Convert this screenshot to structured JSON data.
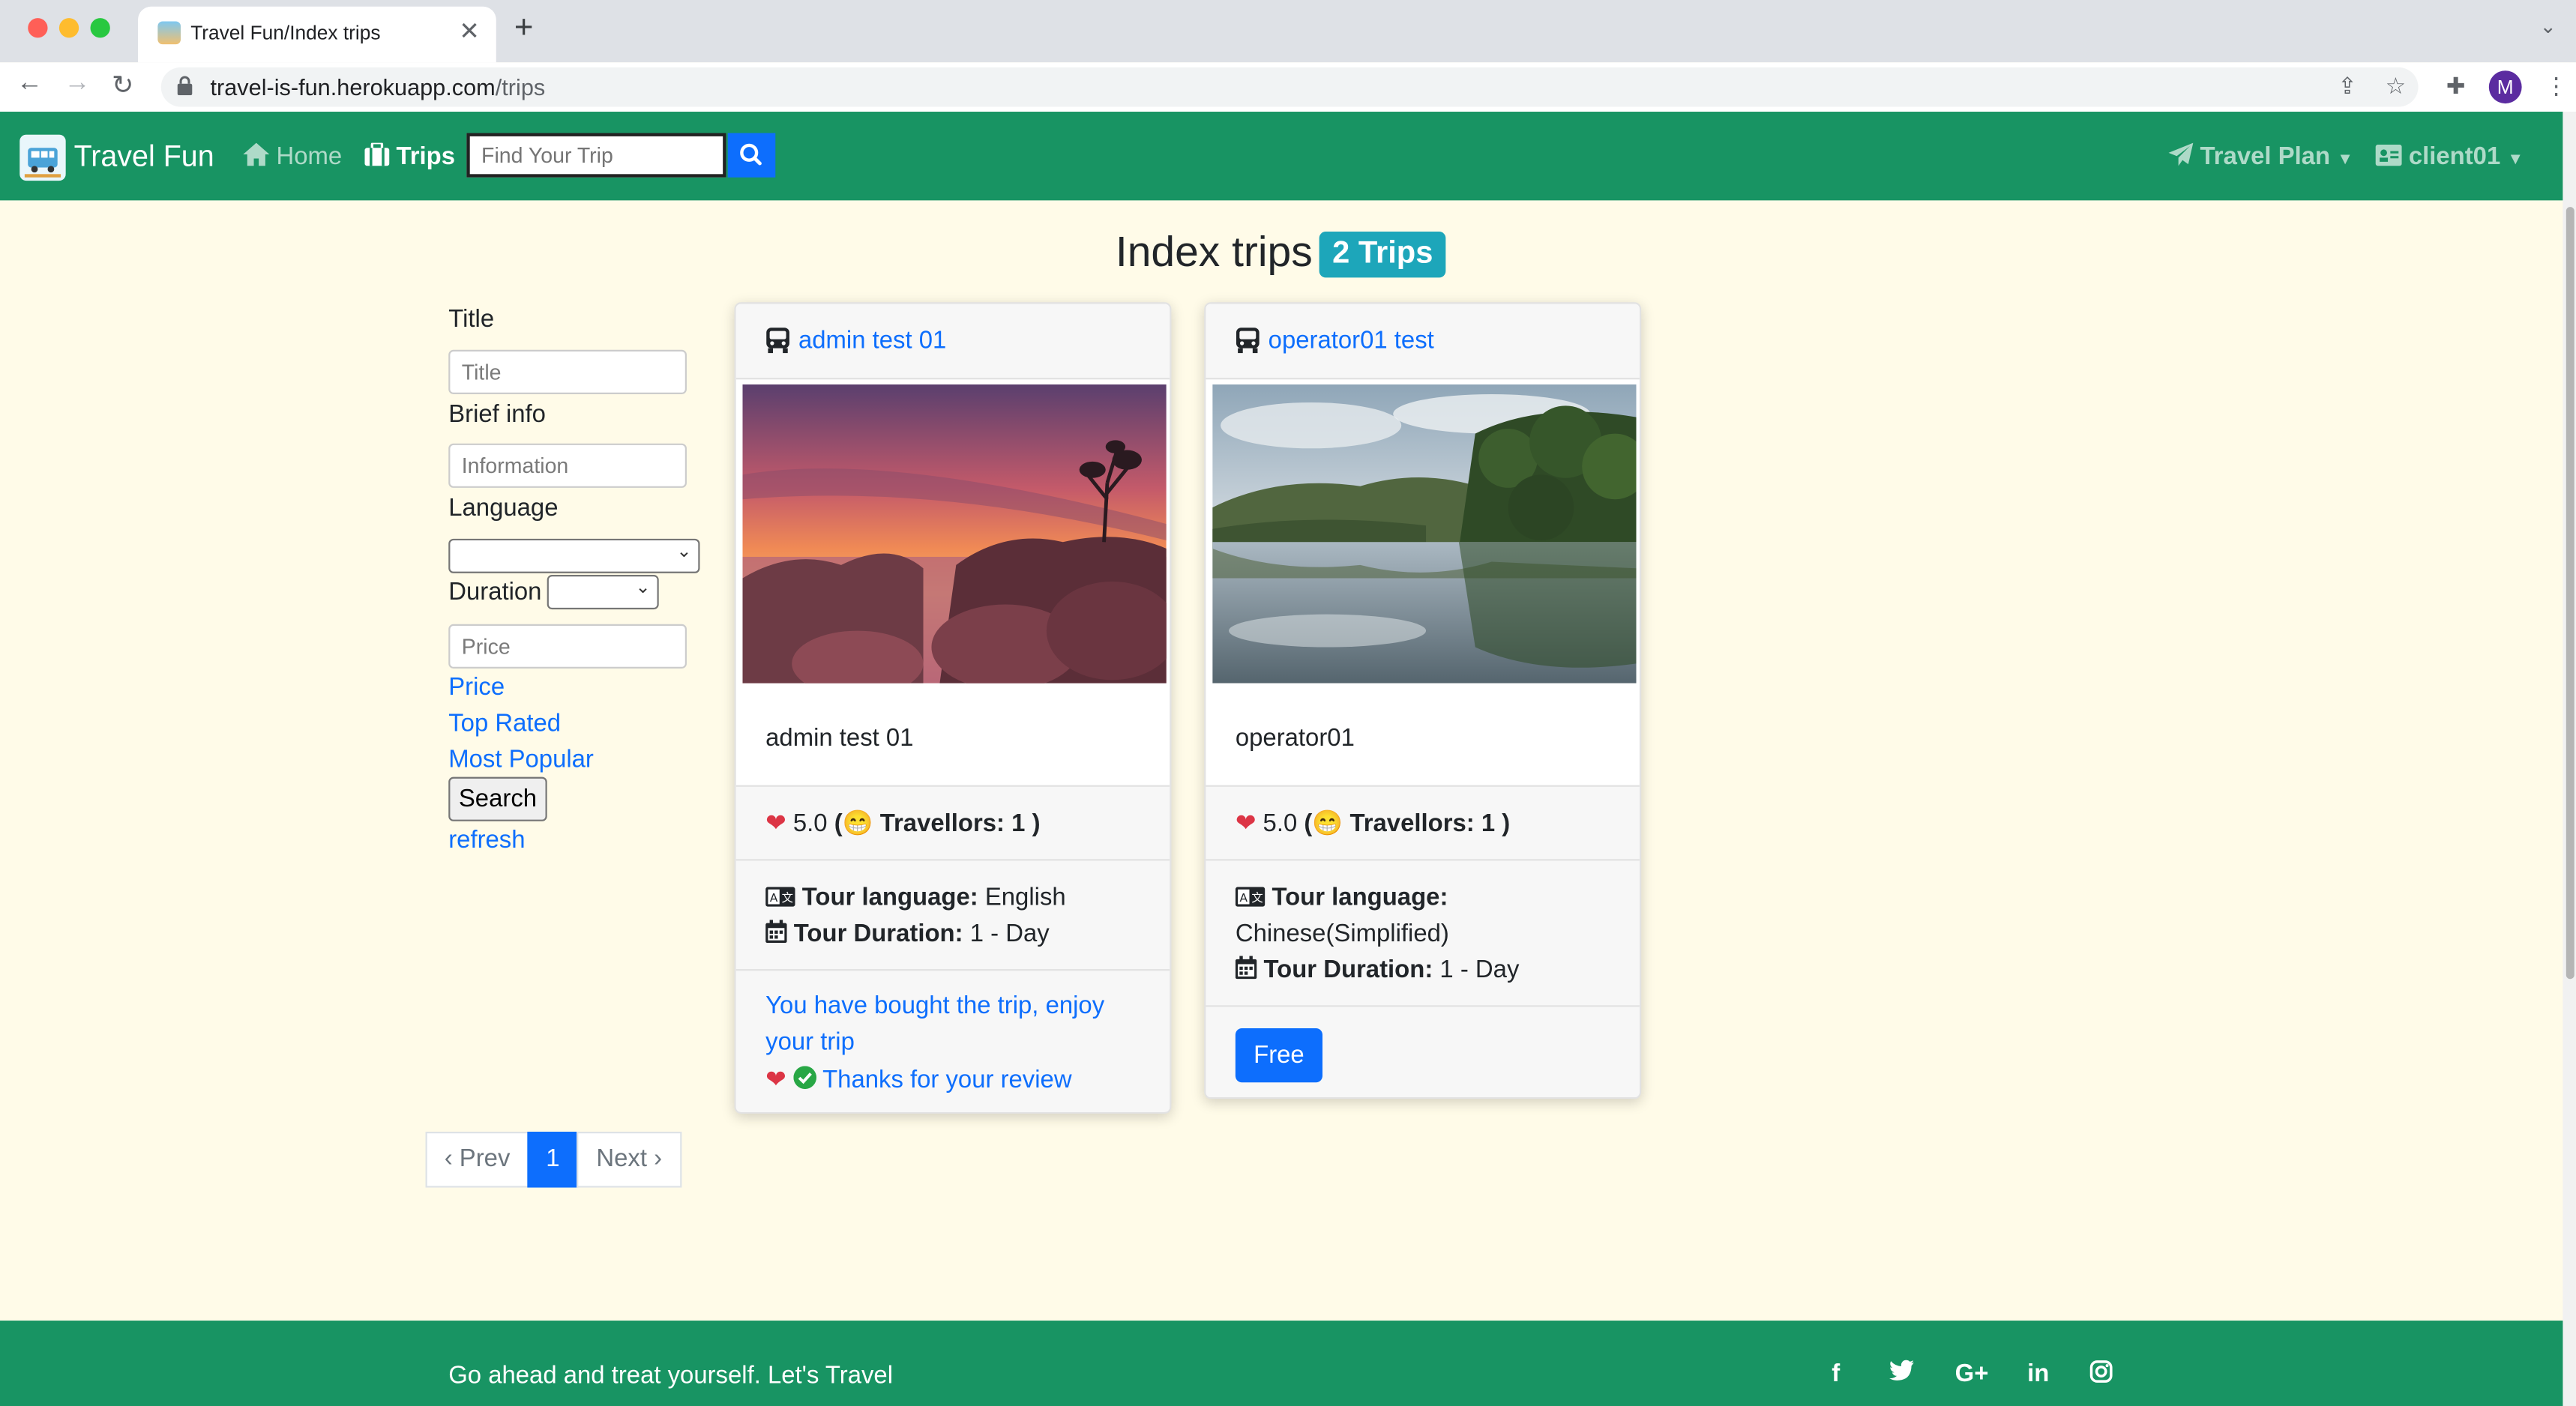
{
  "browser": {
    "tab_title": "Travel Fun/Index trips",
    "url_host": "travel-is-fun.herokuapp.com",
    "url_path": "/trips",
    "profile_initial": "M"
  },
  "navbar": {
    "brand": "Travel Fun",
    "home_label": "Home",
    "trips_label": "Trips",
    "search_placeholder": "Find Your Trip",
    "travel_plan_label": "Travel Plan",
    "user_label": "client01"
  },
  "page": {
    "title": "Index trips",
    "count_badge": "2 Trips"
  },
  "filters": {
    "title_label": "Title",
    "title_placeholder": "Title",
    "info_label": "Brief info",
    "info_placeholder": "Information",
    "language_label": "Language",
    "language_value": "",
    "duration_label": "Duration",
    "duration_value": "",
    "price_placeholder": "Price",
    "sort_links": [
      "Price",
      "Top Rated",
      "Most Popular"
    ],
    "search_button": "Search",
    "refresh_link": "refresh"
  },
  "trips": [
    {
      "title": "admin test 01",
      "description": "admin test 01",
      "rating": "5.0",
      "travellers_label": "Travellors:",
      "travellers": "1",
      "language_label": "Tour language:",
      "language": "English",
      "duration_label": "Tour Duration:",
      "duration": "1 - Day",
      "bought_line1": "You have bought the trip, enjoy",
      "bought_line2": "your trip",
      "review_text": "Thanks for your review"
    },
    {
      "title": "operator01 test",
      "description": "operator01",
      "rating": "5.0",
      "travellers_label": "Travellors:",
      "travellers": "1",
      "language_label": "Tour language:",
      "language": "Chinese(Simplified)",
      "duration_label": "Tour Duration:",
      "duration": "1 - Day",
      "price_button": "Free"
    }
  ],
  "pagination": {
    "prev": "‹ Prev",
    "current": "1",
    "next": "Next ›"
  },
  "footer": {
    "tagline": "Go ahead and treat yourself. Let's Travel",
    "social_icons": [
      "facebook-icon",
      "twitter-icon",
      "google-plus-icon",
      "linkedin-icon",
      "instagram-icon"
    ]
  },
  "colors": {
    "navbar_green": "#189463",
    "page_bg": "#fffbe8",
    "link_blue": "#0d6efd",
    "badge_teal": "#1da6ba",
    "heart_red": "#dc3545"
  }
}
